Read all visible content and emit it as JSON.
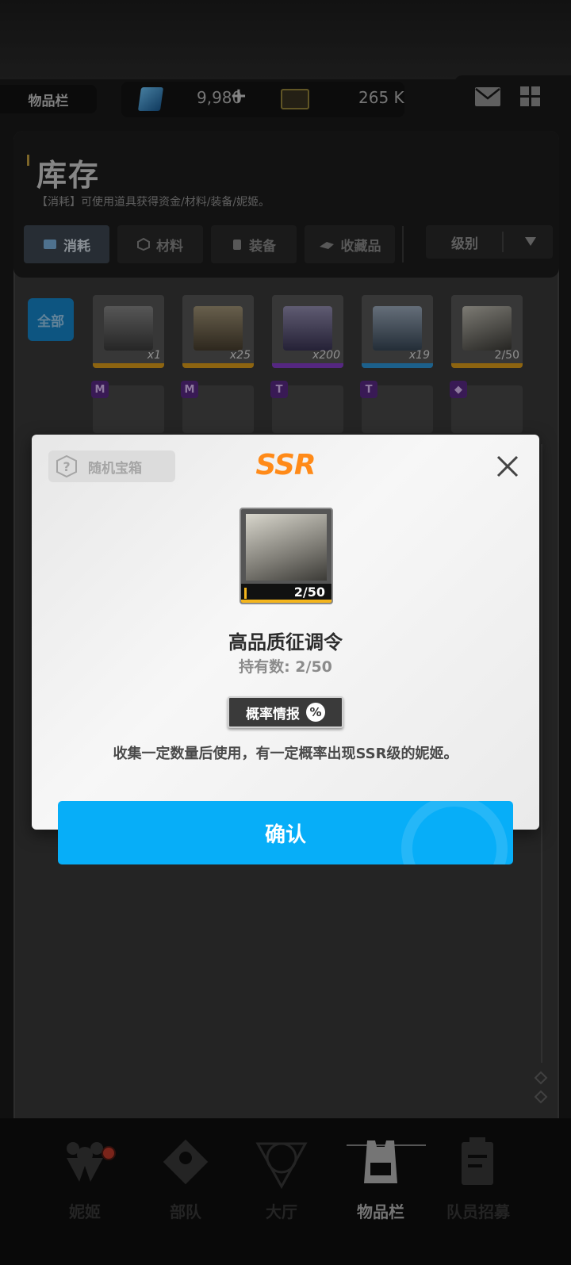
{
  "topbar": {
    "page_label": "物品栏",
    "gems": "9,980",
    "plus": "+",
    "credits": "265 K",
    "icons": [
      "mail-icon",
      "grid-menu-icon"
    ]
  },
  "inventory": {
    "title": "库存",
    "subtitle": "【消耗】可使用道具获得资金/材料/装备/妮姬。",
    "tabs": [
      {
        "label": "消耗",
        "icon": "consumable-icon",
        "active": true
      },
      {
        "label": "材料",
        "icon": "material-icon",
        "active": false
      },
      {
        "label": "装备",
        "icon": "equipment-icon",
        "active": false
      },
      {
        "label": "收藏品",
        "icon": "collectible-icon",
        "active": false
      }
    ],
    "sort_label": "级别",
    "filter_all": "全部",
    "items": [
      {
        "count": "x1",
        "rarity_color": "#e4a21a"
      },
      {
        "count": "x25",
        "rarity_color": "#e4a21a"
      },
      {
        "count": "x200",
        "rarity_color": "#8a3fd1"
      },
      {
        "count": "x19",
        "rarity_color": "#2e9be0"
      },
      {
        "count": "2/50",
        "rarity_color": "#e4a21a"
      }
    ],
    "row2_badges": [
      "M",
      "M",
      "T",
      "T",
      "◆"
    ]
  },
  "dialog": {
    "type_label": "随机宝箱",
    "rarity": "SSR",
    "item_count": "2/50",
    "item_name": "高品质征调令",
    "held": "持有数: 2/50",
    "prob_label": "概率情报",
    "prob_symbol": "%",
    "description": "收集一定数量后使用，有一定概率出现SSR级的妮姬。",
    "confirm": "确认"
  },
  "nav": {
    "items": [
      {
        "label": "妮姬",
        "active": false
      },
      {
        "label": "部队",
        "active": false
      },
      {
        "label": "大厅",
        "active": false
      },
      {
        "label": "物品栏",
        "active": true
      },
      {
        "label": "队员招募",
        "active": false
      }
    ]
  },
  "colors": {
    "accent": "#07aef8",
    "ssr": "#ff8a18",
    "ssr_frame": "#f4b51d"
  }
}
